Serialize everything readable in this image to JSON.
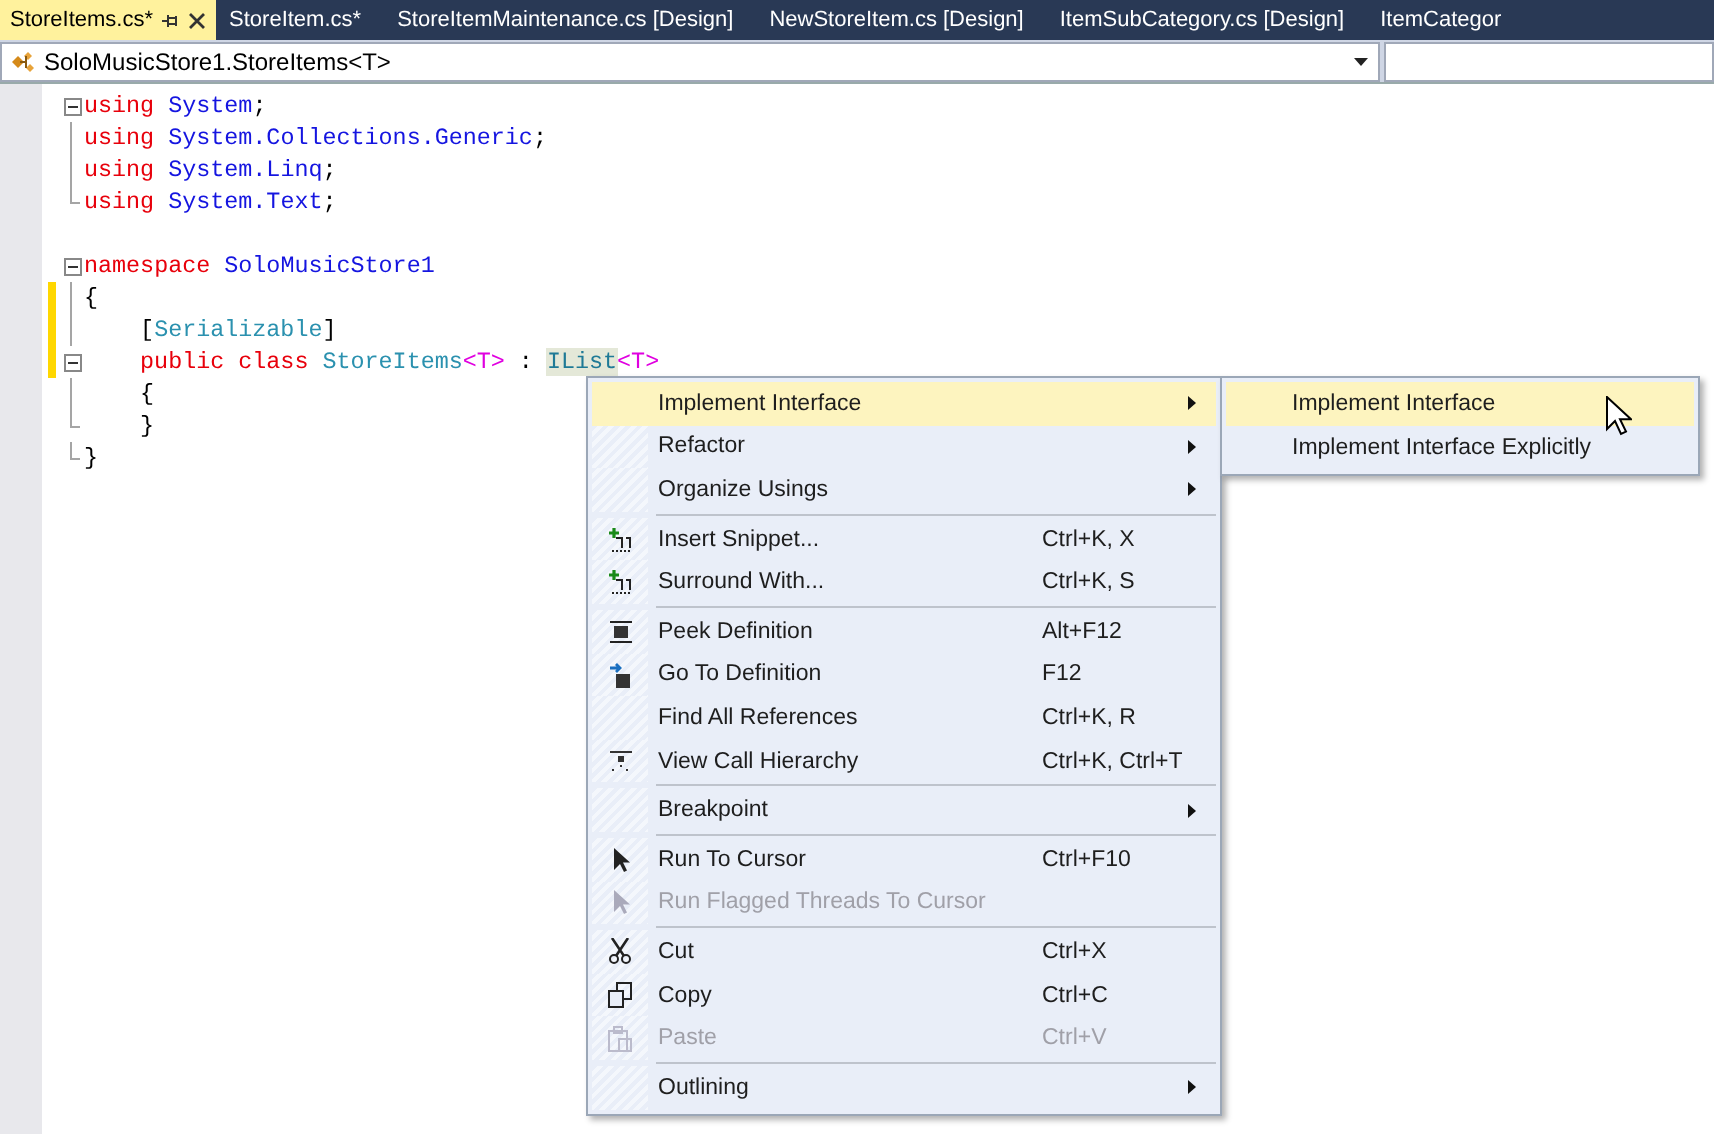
{
  "tabs": [
    {
      "label": "StoreItems.cs*",
      "selected": true
    },
    {
      "label": "StoreItem.cs*",
      "selected": false
    },
    {
      "label": "StoreItemMaintenance.cs [Design]",
      "selected": false
    },
    {
      "label": "NewStoreItem.cs [Design]",
      "selected": false
    },
    {
      "label": "ItemSubCategory.cs [Design]",
      "selected": false
    },
    {
      "label": "ItemCategor",
      "selected": false
    }
  ],
  "navigation_bar": {
    "type_selector": "SoloMusicStore1.StoreItems<T>"
  },
  "code_lines": [
    {
      "collapsible": true,
      "fold_end": false,
      "changed": false,
      "tokens": [
        {
          "text": "using",
          "kind": "keyword"
        },
        {
          "text": " System",
          "kind": "namespace"
        },
        {
          "text": ";",
          "kind": "plain"
        }
      ]
    },
    {
      "collapsible": false,
      "fold_end": false,
      "changed": false,
      "tokens": [
        {
          "text": "using",
          "kind": "keyword"
        },
        {
          "text": " System.Collections.Generic",
          "kind": "namespace"
        },
        {
          "text": ";",
          "kind": "plain"
        }
      ]
    },
    {
      "collapsible": false,
      "fold_end": false,
      "changed": false,
      "tokens": [
        {
          "text": "using",
          "kind": "keyword"
        },
        {
          "text": " System.Linq",
          "kind": "namespace"
        },
        {
          "text": ";",
          "kind": "plain"
        }
      ]
    },
    {
      "collapsible": false,
      "fold_end": true,
      "changed": false,
      "tokens": [
        {
          "text": "using",
          "kind": "keyword"
        },
        {
          "text": " System.Text",
          "kind": "namespace"
        },
        {
          "text": ";",
          "kind": "plain"
        }
      ]
    },
    {
      "collapsible": false,
      "fold_end": false,
      "changed": false
    },
    {
      "collapsible": true,
      "fold_end": false,
      "changed": false,
      "tokens": [
        {
          "text": "namespace",
          "kind": "keyword"
        },
        {
          "text": " SoloMusicStore1",
          "kind": "namespace"
        }
      ]
    },
    {
      "collapsible": false,
      "fold_end": false,
      "changed": true,
      "tokens": [
        {
          "text": "{",
          "kind": "plain"
        }
      ],
      "children": [
        {
          "collapsible": false,
          "fold_end": false,
          "changed": true,
          "tokens": [
            {
              "text": "[",
              "kind": "plain"
            },
            {
              "text": "Serializable",
              "kind": "type"
            },
            {
              "text": "]",
              "kind": "plain"
            }
          ]
        },
        {
          "collapsible": true,
          "fold_end": false,
          "changed": true,
          "tokens": [
            {
              "text": "public class",
              "kind": "keyword"
            },
            {
              "text": " StoreItems",
              "kind": "type"
            },
            {
              "text": "<T>",
              "kind": "typeparam"
            },
            {
              "text": " : ",
              "kind": "plain"
            },
            {
              "text": "IList",
              "kind": "reference"
            },
            {
              "text": "<T>",
              "kind": "typeparam"
            }
          ]
        },
        {
          "collapsible": false,
          "fold_end": false,
          "changed": false,
          "tokens": [
            {
              "text": "{",
              "kind": "plain"
            }
          ]
        },
        {
          "collapsible": false,
          "fold_end": true,
          "changed": false,
          "tokens": [
            {
              "text": "}",
              "kind": "plain"
            }
          ]
        }
      ]
    },
    {
      "collapsible": false,
      "fold_end": true,
      "changed": false,
      "tokens": [
        {
          "text": "}",
          "kind": "plain"
        }
      ]
    }
  ],
  "context_menu": [
    {
      "kind": "item",
      "label": "Implement Interface",
      "submenu": true,
      "disabled": false,
      "selected": true
    },
    {
      "kind": "item",
      "label": "Refactor",
      "submenu": true,
      "disabled": false,
      "selected": false
    },
    {
      "kind": "item",
      "label": "Organize Usings",
      "submenu": true,
      "disabled": false,
      "selected": false
    },
    {
      "kind": "separator"
    },
    {
      "kind": "item",
      "label": "Insert Snippet...",
      "shortcut": "Ctrl+K, X",
      "submenu": false,
      "disabled": false,
      "selected": false
    },
    {
      "kind": "item",
      "label": "Surround With...",
      "shortcut": "Ctrl+K, S",
      "submenu": false,
      "disabled": false,
      "selected": false
    },
    {
      "kind": "separator"
    },
    {
      "kind": "item",
      "label": "Peek Definition",
      "shortcut": "Alt+F12",
      "submenu": false,
      "disabled": false,
      "selected": false
    },
    {
      "kind": "item",
      "label": "Go To Definition",
      "shortcut": "F12",
      "submenu": false,
      "disabled": false,
      "selected": false
    },
    {
      "kind": "item",
      "label": "Find All References",
      "shortcut": "Ctrl+K, R",
      "submenu": false,
      "disabled": false,
      "selected": false
    },
    {
      "kind": "item",
      "label": "View Call Hierarchy",
      "shortcut": "Ctrl+K, Ctrl+T",
      "submenu": false,
      "disabled": false,
      "selected": false
    },
    {
      "kind": "separator"
    },
    {
      "kind": "item",
      "label": "Breakpoint",
      "submenu": true,
      "disabled": false,
      "selected": false
    },
    {
      "kind": "separator"
    },
    {
      "kind": "item",
      "label": "Run To Cursor",
      "shortcut": "Ctrl+F10",
      "submenu": false,
      "disabled": false,
      "selected": false
    },
    {
      "kind": "item",
      "label": "Run Flagged Threads To Cursor",
      "submenu": false,
      "disabled": true,
      "selected": false
    },
    {
      "kind": "separator"
    },
    {
      "kind": "item",
      "label": "Cut",
      "shortcut": "Ctrl+X",
      "submenu": false,
      "disabled": false,
      "selected": false
    },
    {
      "kind": "item",
      "label": "Copy",
      "shortcut": "Ctrl+C",
      "submenu": false,
      "disabled": false,
      "selected": false
    },
    {
      "kind": "item",
      "label": "Paste",
      "shortcut": "Ctrl+V",
      "submenu": false,
      "disabled": true,
      "selected": false
    },
    {
      "kind": "separator"
    },
    {
      "kind": "item",
      "label": "Outlining",
      "submenu": true,
      "disabled": false,
      "selected": false
    }
  ],
  "submenu": [
    {
      "label": "Implement Interface",
      "selected": true
    },
    {
      "label": "Implement Interface Explicitly",
      "selected": false
    }
  ]
}
